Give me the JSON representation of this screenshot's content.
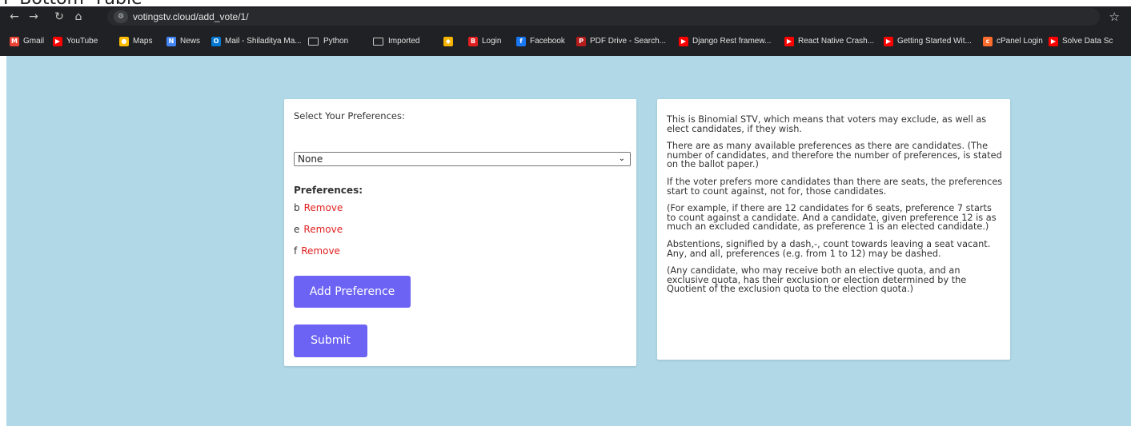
{
  "top_strip_text": "P  Bottom-  Fable",
  "browser": {
    "url": "votingstv.cloud/add_vote/1/",
    "bookmarks": [
      {
        "label": "Gmail",
        "icon": "gmail-icon",
        "color": "#ea4335"
      },
      {
        "label": "YouTube",
        "icon": "youtube-icon",
        "color": "#ff0000"
      },
      {
        "label": "Maps",
        "icon": "maps-icon",
        "color": "#fbbc04"
      },
      {
        "label": "News",
        "icon": "news-icon",
        "color": "#4285f4"
      },
      {
        "label": "Mail - Shiladitya Ma...",
        "icon": "outlook-icon",
        "color": "#0078d4"
      },
      {
        "label": "Python",
        "icon": "folder-icon",
        "color": ""
      },
      {
        "label": "Imported",
        "icon": "folder-icon",
        "color": ""
      },
      {
        "label": "",
        "icon": "extension-icon",
        "color": "#f4b400"
      },
      {
        "label": "Login",
        "icon": "b-icon",
        "color": "#e02020"
      },
      {
        "label": "Facebook",
        "icon": "facebook-icon",
        "color": "#1877f2"
      },
      {
        "label": "PDF Drive - Search...",
        "icon": "pdf-drive-icon",
        "color": "#b71c1c"
      },
      {
        "label": "Django Rest framew...",
        "icon": "youtube-icon",
        "color": "#ff0000"
      },
      {
        "label": "React Native Crash...",
        "icon": "youtube-icon",
        "color": "#ff0000"
      },
      {
        "label": "Getting Started Wit...",
        "icon": "youtube-icon",
        "color": "#ff0000"
      },
      {
        "label": "cPanel Login",
        "icon": "cpanel-icon",
        "color": "#ff6c2c"
      },
      {
        "label": "Solve Data Sc",
        "icon": "youtube-icon",
        "color": "#ff0000"
      }
    ]
  },
  "form": {
    "select_label": "Select Your Preferences:",
    "select_value": "None",
    "preferences_heading": "Preferences:",
    "preferences": [
      {
        "name": "b",
        "remove_label": "Remove"
      },
      {
        "name": "e",
        "remove_label": "Remove"
      },
      {
        "name": "f",
        "remove_label": "Remove"
      }
    ],
    "add_button": "Add Preference",
    "submit_button": "Submit"
  },
  "info": {
    "paragraphs": [
      "This is Binomial STV, which means that voters may exclude, as well as elect candidates, if they wish.",
      "There are as many available preferences as there are candidates. (The number of candidates, and therefore the number of preferences, is stated on the ballot paper.)",
      "If the voter prefers more candidates than there are seats, the preferences start to count against, not for, those candidates.",
      "(For example, if there are 12 candidates for 6 seats, preference 7 starts to count against a candidate. And a candidate, given preference 12 is as much an excluded candidate, as preference 1 is an elected candidate.)",
      "Abstentions, signified by a dash,-, count towards leaving a seat vacant. Any, and all, preferences (e.g. from 1 to 12) may be dashed.",
      "(Any candidate, who may receive both an elective quota, and an exclusive quota, has their exclusion or election determined by the Quotient of the exclusion quota to the election quota.)"
    ]
  },
  "colors": {
    "page_background": "#b0d8e6",
    "button": "#6c63f4",
    "remove_link": "#e02020"
  }
}
